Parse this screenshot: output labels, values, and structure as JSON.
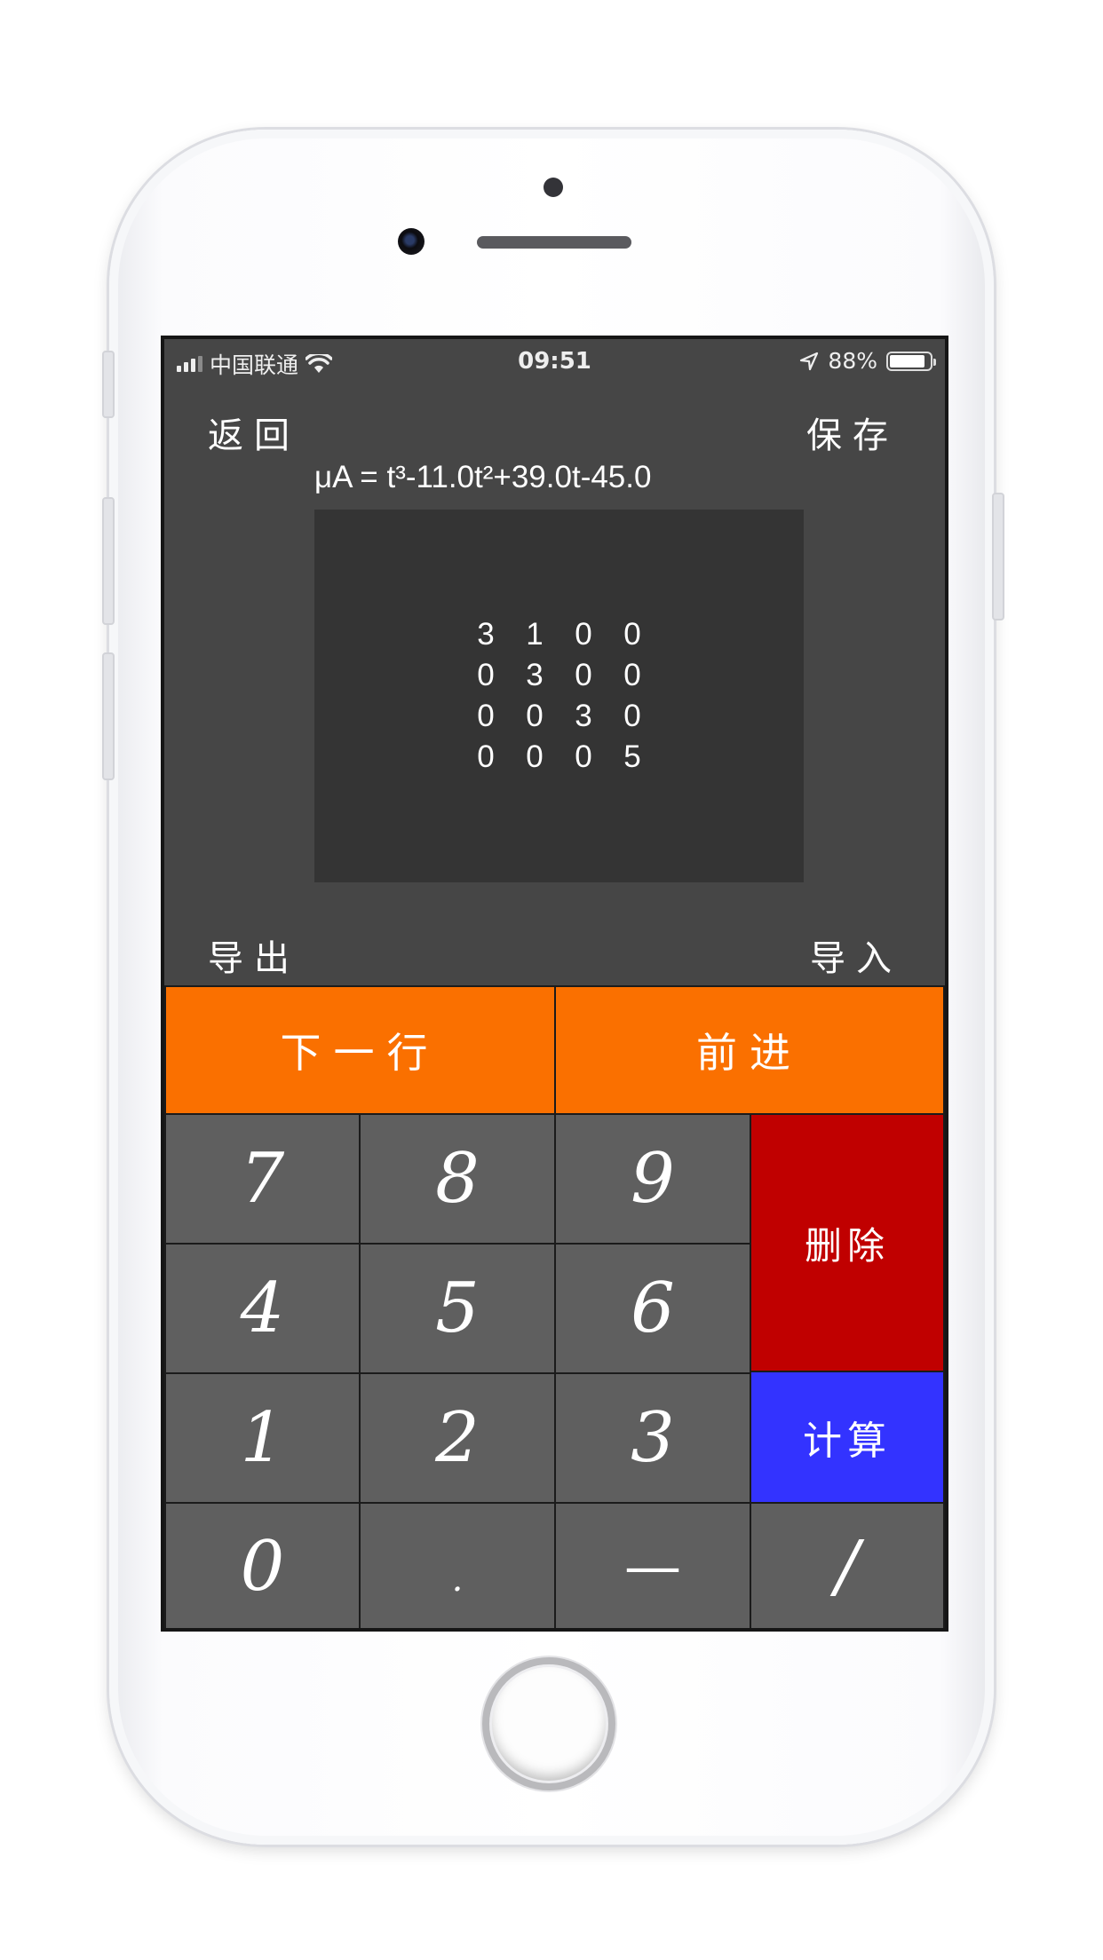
{
  "status_bar": {
    "carrier": "中国联通",
    "time": "09:51",
    "battery": "88%",
    "battery_level": 0.88,
    "signal_bars": 4,
    "signal_active": 3
  },
  "nav": {
    "back_label": "返回",
    "save_label": "保存",
    "export_label": "导出",
    "import_label": "导入"
  },
  "formula": "μA = t³-11.0t²+39.0t-45.0",
  "matrix": [
    [
      "3",
      "1",
      "0",
      "0"
    ],
    [
      "0",
      "3",
      "0",
      "0"
    ],
    [
      "0",
      "0",
      "3",
      "0"
    ],
    [
      "0",
      "0",
      "0",
      "5"
    ]
  ],
  "keypad": {
    "next_row_label": "下一行",
    "forward_label": "前进",
    "delete_label": "删除",
    "calculate_label": "计算",
    "keys": {
      "seven": "7",
      "eight": "8",
      "nine": "9",
      "four": "4",
      "five": "5",
      "six": "6",
      "one": "1",
      "two": "2",
      "three": "3",
      "zero": "0",
      "dot": ".",
      "minus": "—",
      "slash": "/"
    }
  },
  "colors": {
    "screen_bg": "#464646",
    "matrix_bg": "#343434",
    "key_gray": "#5f5f5f",
    "accent_orange": "#fa7000",
    "delete_red": "#c00000",
    "calculate_blue": "#3333ff"
  }
}
